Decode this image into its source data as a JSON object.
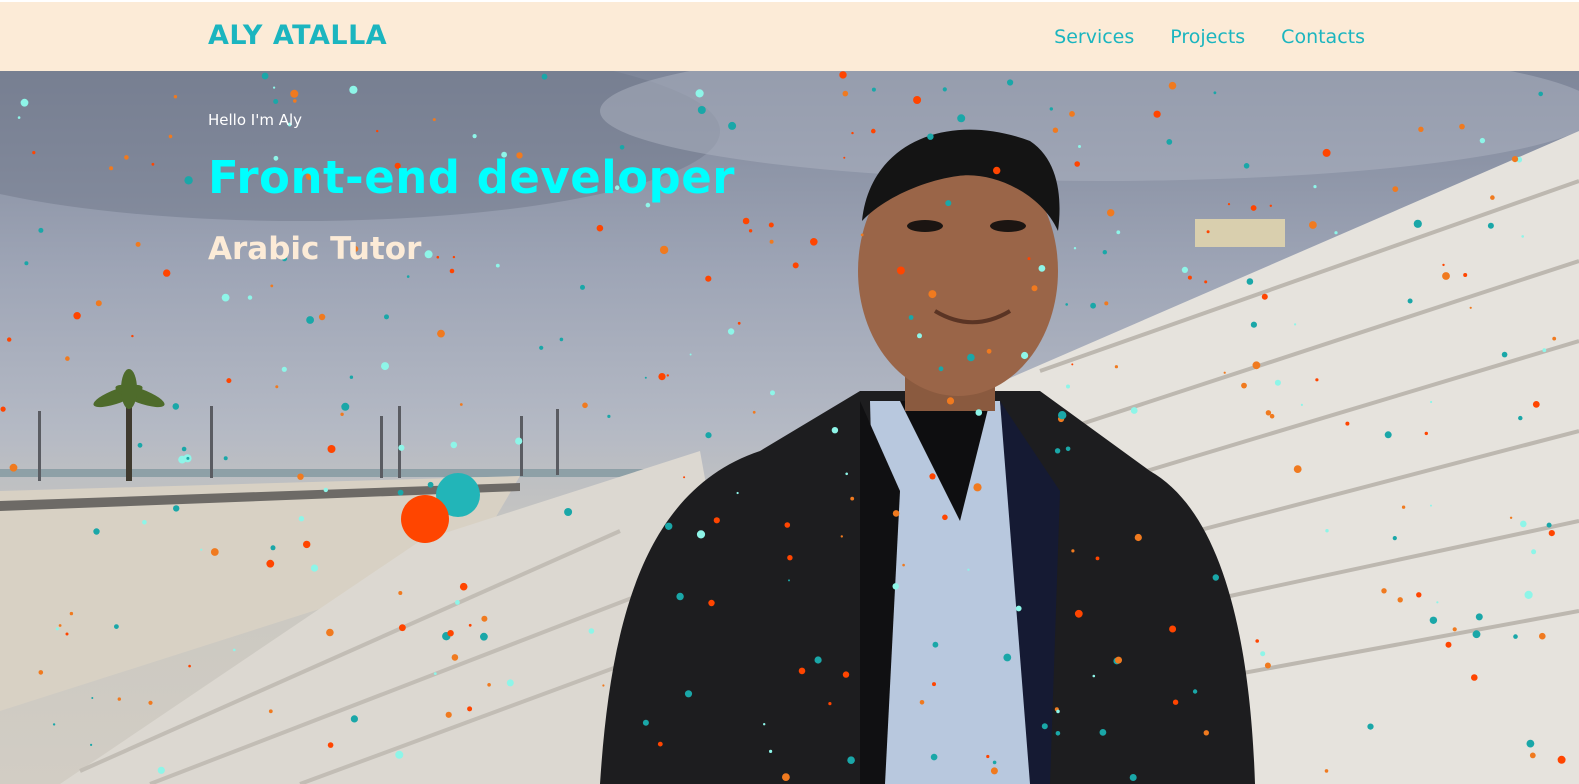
{
  "nav": {
    "brand": "ALY ATALLA",
    "links": [
      "Services",
      "Projects",
      "Contacts"
    ]
  },
  "hero": {
    "greeting": "Hello I'm Aly",
    "title": "Front-end developer",
    "subtitle": "Arabic Tutor"
  },
  "colors": {
    "nav_background": "#fcebd7",
    "accent_teal": "#1bb5bf",
    "title_cyan": "#00ffff",
    "particle_orange": "#ff4500",
    "particle_teal": "#1aa7a8",
    "particle_light": "#8ef5e8",
    "subtitle_cream": "#fcebd7"
  }
}
